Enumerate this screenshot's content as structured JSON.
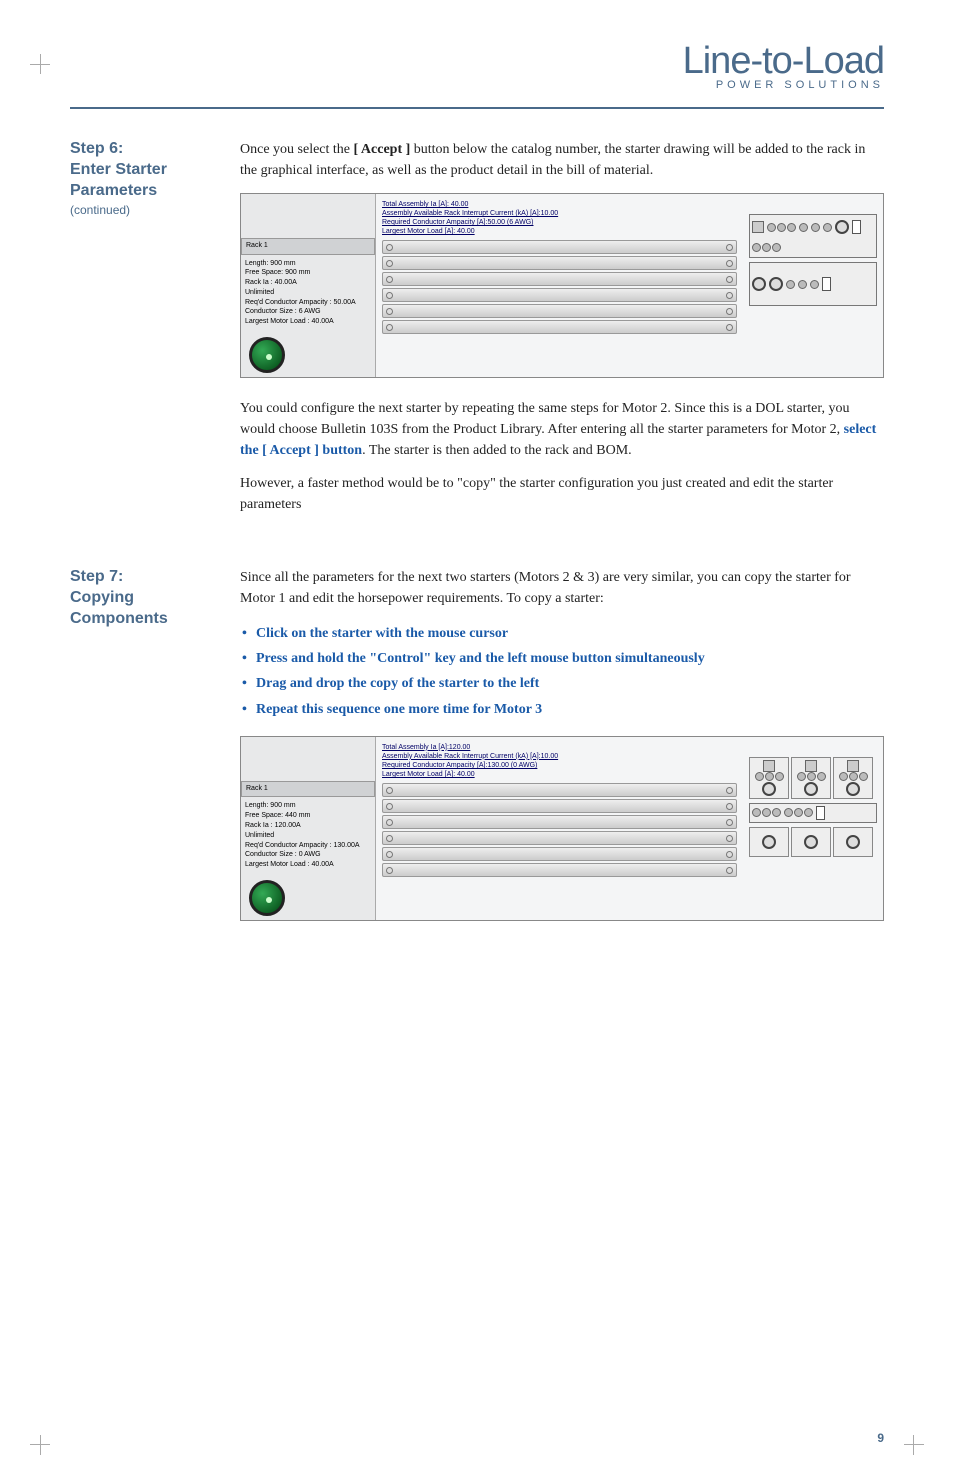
{
  "logo": {
    "main": "Line-to-Load",
    "sub": "POWER SOLUTIONS"
  },
  "step6": {
    "title": "Step 6:",
    "subtitle": "Enter Starter Parameters",
    "continued": "(continued)",
    "para1_pre": "Once you select the ",
    "para1_bold": "[ Accept ]",
    "para1_post": " button below the catalog number, the starter drawing will be added to the rack in the graphical interface, as well as the product detail in the bill of material.",
    "para2_pre": "You could configure the next starter by repeating the same steps for Motor 2. Since this is a DOL starter, you would choose Bulletin 103S from the Product Library. After entering all the starter parameters for Motor 2, ",
    "para2_link": "select the [ Accept ] button",
    "para2_post": ". The starter is then added to the rack and BOM.",
    "para3": "However, a faster method would be to \"copy\" the starter configuration you just created and edit the starter parameters"
  },
  "step7": {
    "title": "Step 7:",
    "subtitle": "Copying Components",
    "para1": "Since all the parameters for the next two starters (Motors 2 & 3) are very similar, you can copy the starter for Motor 1 and edit the horsepower requirements. To copy a starter:",
    "bullets": [
      "Click on the starter with the mouse cursor",
      "Press and hold the \"Control\" key and the left mouse button simultaneously",
      "Drag and drop the copy of the starter to the left",
      "Repeat this sequence one more time for Motor 3"
    ]
  },
  "screenshot1": {
    "rackName": "Rack 1",
    "lines": [
      "Length: 900 mm",
      "Free Space: 900 mm",
      "Rack Ia : 40.00A",
      "Unlimited",
      "Req'd Conductor Ampacity : 50.00A",
      "Conductor Size : 6 AWG",
      "Largest Motor Load : 40.00A"
    ],
    "topInfo": [
      "Total Assembly Ia [A]: 40.00",
      "Assembly Available Rack Interrupt Current (kA) [A]:10.00",
      "Required Conductor Ampacity [A]:50.00 (6 AWG)",
      "Largest Motor Load [A]: 40.00"
    ]
  },
  "screenshot2": {
    "rackName": "Rack 1",
    "lines": [
      "Length: 900 mm",
      "Free Space: 440 mm",
      "Rack Ia : 120.00A",
      "Unlimited",
      "Req'd Conductor Ampacity : 130.00A",
      "Conductor Size : 0 AWG",
      "Largest Motor Load : 40.00A"
    ],
    "topInfo": [
      "Total Assembly Ia [A]:120.00",
      "Assembly Available Rack Interrupt Current (kA) [A]:10.00",
      "Required Conductor Ampacity [A]:130.00 (0 AWG)",
      "Largest Motor Load [A]: 40.00"
    ]
  },
  "pageNumber": "9"
}
